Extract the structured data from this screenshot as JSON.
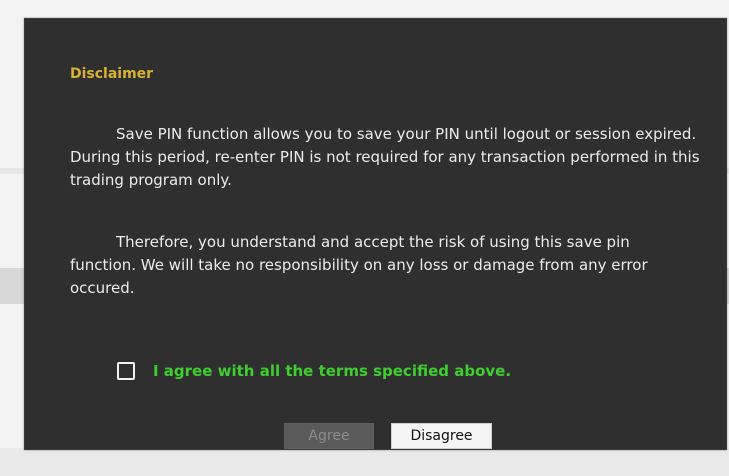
{
  "dialog": {
    "title": "Disclaimer",
    "paragraphs": [
      "Save PIN function allows you to save your PIN until logout or session expired. During this period, re-enter PIN is not required for any transaction performed in this trading program only.",
      "Therefore, you understand and accept the risk of using this save pin function. We will take no responsibility on any loss or damage from any error occured."
    ],
    "agree_checkbox": {
      "label": "I agree with all the terms specified above.",
      "checked": false
    },
    "buttons": {
      "agree_label": "Agree",
      "agree_disabled": true,
      "disagree_label": "Disagree"
    }
  },
  "colors": {
    "modal_bg": "#2f2f2f",
    "title": "#d9b233",
    "body_text": "#ececec",
    "agree_text": "#3ecf2e",
    "disabled_button_bg": "#5a5a5a",
    "disabled_button_text": "#8d8d8d",
    "button_bg": "#f5f5f5"
  }
}
